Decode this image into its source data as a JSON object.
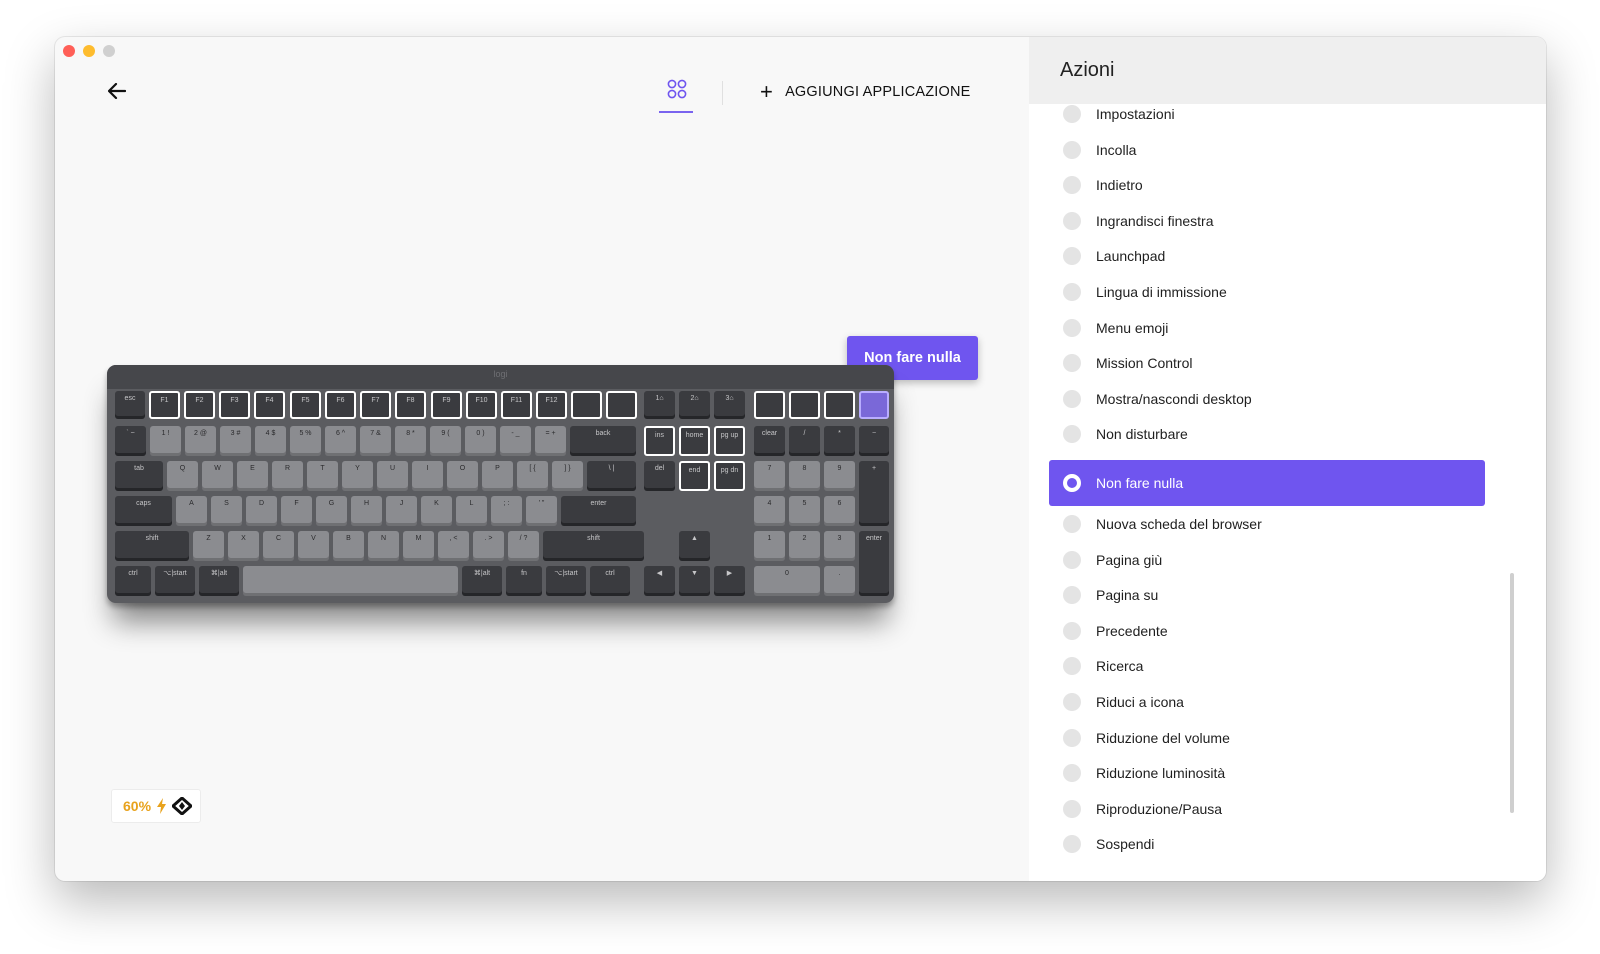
{
  "window": {
    "traffic_lights": [
      "close",
      "minimize",
      "zoom"
    ]
  },
  "toolbar": {
    "back_icon": "arrow-left-icon",
    "apps_icon": "apps-grid-icon",
    "add_app_label": "AGGIUNGI APPLICAZIONE"
  },
  "tooltip": {
    "label": "Non fare nulla"
  },
  "keyboard": {
    "logo": "logi",
    "rows": [
      [
        "esc",
        "F1",
        "F2",
        "F3",
        "F4",
        "F5",
        "F6",
        "F7",
        "F8",
        "F9",
        "F10",
        "F11",
        "F12",
        "",
        "",
        "1⌂",
        "2⌂",
        "3⌂",
        "",
        "",
        "",
        ""
      ],
      [
        "` ~",
        "1 !",
        "2 @",
        "3 #",
        "4 $",
        "5 %",
        "6 ^",
        "7 &",
        "8 *",
        "9 (",
        "0 )",
        "- _",
        "= +",
        "back",
        "ins",
        "home",
        "pg up",
        "clear",
        "/",
        "*",
        "−"
      ],
      [
        "tab",
        "Q",
        "W",
        "E",
        "R",
        "T",
        "Y",
        "U",
        "I",
        "O",
        "P",
        "[ {",
        "] }",
        "\\ |",
        "del",
        "end",
        "pg dn",
        "7",
        "8",
        "9",
        "+"
      ],
      [
        "caps",
        "A",
        "S",
        "D",
        "F",
        "G",
        "H",
        "J",
        "K",
        "L",
        "; :",
        "' \"",
        "enter",
        "4",
        "5",
        "6"
      ],
      [
        "shift",
        "Z",
        "X",
        "C",
        "V",
        "B",
        "N",
        "M",
        ", <",
        ". >",
        "/ ?",
        "shift",
        "▲",
        "1",
        "2",
        "3",
        "enter"
      ],
      [
        "ctrl",
        "⌥|start",
        "⌘|alt",
        "",
        "⌘|alt",
        "fn",
        "⌥|start",
        "ctrl",
        "◀",
        "▼",
        "▶",
        "0",
        "."
      ]
    ],
    "sub_labels": {
      "home": "home",
      "end": "end",
      "pgup": "pg up",
      "pgdn": "pg dn",
      "ins": "ins",
      "del": "del"
    }
  },
  "battery": {
    "percent": "60%",
    "charging_icon": "lightning-icon",
    "connection_icon": "logi-bolt-icon",
    "accent": "#e8a21c"
  },
  "panel": {
    "title": "Azioni",
    "accent": "#6f55ef",
    "items": [
      {
        "label": "Impostazioni",
        "selected": false
      },
      {
        "label": "Incolla",
        "selected": false
      },
      {
        "label": "Indietro",
        "selected": false
      },
      {
        "label": "Ingrandisci finestra",
        "selected": false
      },
      {
        "label": "Launchpad",
        "selected": false
      },
      {
        "label": "Lingua di immissione",
        "selected": false
      },
      {
        "label": "Menu emoji",
        "selected": false
      },
      {
        "label": "Mission Control",
        "selected": false
      },
      {
        "label": "Mostra/nascondi desktop",
        "selected": false
      },
      {
        "label": "Non disturbare",
        "selected": false
      },
      {
        "label": "Non fare nulla",
        "selected": true
      },
      {
        "label": "Nuova scheda del browser",
        "selected": false
      },
      {
        "label": "Pagina giù",
        "selected": false
      },
      {
        "label": "Pagina su",
        "selected": false
      },
      {
        "label": "Precedente",
        "selected": false
      },
      {
        "label": "Ricerca",
        "selected": false
      },
      {
        "label": "Riduci a icona",
        "selected": false
      },
      {
        "label": "Riduzione del volume",
        "selected": false
      },
      {
        "label": "Riduzione luminosità",
        "selected": false
      },
      {
        "label": "Riproduzione/Pausa",
        "selected": false
      },
      {
        "label": "Sospendi",
        "selected": false
      }
    ]
  }
}
